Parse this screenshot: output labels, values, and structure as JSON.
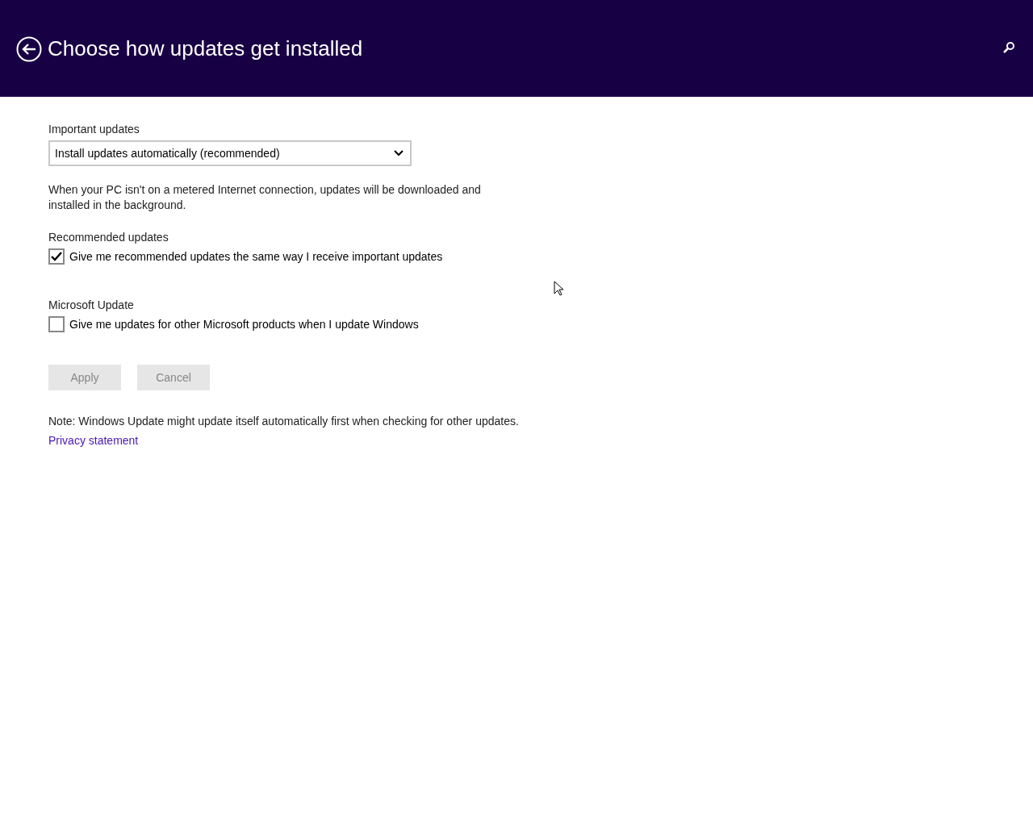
{
  "header": {
    "title": "Choose how updates get installed"
  },
  "important_updates": {
    "label": "Important updates",
    "dropdown_value": "Install updates automatically (recommended)",
    "description": "When your PC isn't on a metered Internet connection, updates will be downloaded and installed in the background."
  },
  "recommended_updates": {
    "label": "Recommended updates",
    "checkbox": {
      "label": "Give me recommended updates the same way I receive important updates",
      "checked": true
    }
  },
  "microsoft_update": {
    "label": "Microsoft Update",
    "checkbox": {
      "label": "Give me updates for other Microsoft products when I update Windows",
      "checked": false
    }
  },
  "buttons": [
    {
      "label": "Apply",
      "disabled": true
    },
    {
      "label": "Cancel",
      "disabled": true
    }
  ],
  "note": "Note: Windows Update might update itself automatically first when checking for other updates.",
  "link": "Privacy statement"
}
